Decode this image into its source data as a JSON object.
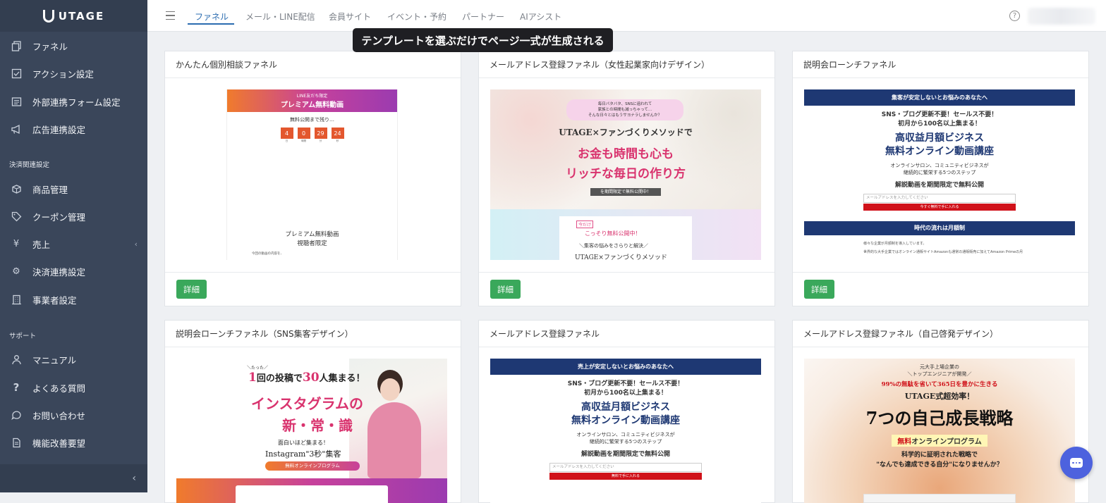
{
  "sidebar": {
    "logo": "UTAGE",
    "items_main": [
      {
        "label": "ファネル",
        "icon": "copy-icon"
      },
      {
        "label": "アクション設定",
        "icon": "checkbox-icon"
      },
      {
        "label": "外部連携フォーム設定",
        "icon": "list-icon"
      },
      {
        "label": "広告連携設定",
        "icon": "megaphone-icon"
      }
    ],
    "section_payment": "決済関連設定",
    "items_payment": [
      {
        "label": "商品管理",
        "icon": "box-icon"
      },
      {
        "label": "クーポン管理",
        "icon": "tag-icon"
      },
      {
        "label": "売上",
        "icon": "yen-icon"
      },
      {
        "label": "決済連携設定",
        "icon": "gear-icon"
      },
      {
        "label": "事業者設定",
        "icon": "building-icon"
      }
    ],
    "section_support": "サポート",
    "items_support": [
      {
        "label": "マニュアル",
        "icon": "person-icon"
      },
      {
        "label": "よくある質問",
        "icon": "question-icon"
      },
      {
        "label": "お問い合わせ",
        "icon": "chat-icon"
      },
      {
        "label": "機能改善要望",
        "icon": "document-icon"
      }
    ]
  },
  "topbar": {
    "tabs": [
      "ファネル",
      "メール・LINE配信",
      "会員サイト",
      "イベント・予約",
      "パートナー",
      "AIアシスト"
    ],
    "active_tab": "ファネル"
  },
  "banner": "テンプレートを選ぶだけでページ一式が生成される",
  "cards": [
    {
      "title": "かんたん個別相談ファネル",
      "button": "詳細",
      "preview": {
        "top": "LINE友だち限定",
        "headline": "プレミアム無料動画",
        "sub": "無料公開まで残り…",
        "countdown": [
          "4",
          "0",
          "29",
          "24"
        ],
        "units": [
          "日",
          "時間",
          "分",
          "秒"
        ],
        "bottom1": "プレミアム無料動画",
        "bottom2": "視聴者限定",
        "small": "今回の動画の内容を、"
      }
    },
    {
      "title": "メールアドレス登録ファネル（女性起業家向けデザイン）",
      "button": "詳細",
      "preview": {
        "bubble1": "毎日バタバタ、SNSに追われて",
        "bubble2": "家族との時間も減っちゃって…",
        "bubble3": "そんな日々とはもうサヨナラしませんか？",
        "line1": "UTAGE×ファンづくりメソッドで",
        "line2": "お金も時間も心も",
        "line3": "リッチな毎日の作り方",
        "badge": "を期間限定で無料公開中！",
        "stamp": "今だけ",
        "sub1": "こっそり無料公開中！",
        "sub2": "＼集客の悩みをさらりと解決／",
        "sub3": "UTAGE×ファンづくりメソッド"
      }
    },
    {
      "title": "説明会ローンチファネル",
      "button": "詳細",
      "preview": {
        "header": "集客が安定しないとお悩みのあなたへ",
        "l1": "SNS・ブログ更新不要！セールス不要！",
        "l2": "初月から100名以上集まる！",
        "h1": "高収益月額ビジネス",
        "h2": "無料オンライン動画講座",
        "s1": "オンラインサロン、コミュニティビジネスが",
        "s2": "継続的に繁栄する5つのステップ",
        "b": "解説動画を期間限定で無料公開",
        "placeholder": "メールアドレスを入力してください",
        "cta": "今すぐ無料で手に入れる",
        "header2": "時代の流れは月額制",
        "p1": "様々な企業が月額制を導入しています。",
        "p2": "世界的な大手企業ではオンライン通販サイトAmazonも通常の通販販売に加えてAmazon Primeの月"
      }
    },
    {
      "title": "説明会ローンチファネル（SNS集客デザイン）",
      "preview": {
        "top": "＼たった／",
        "l1a": "1",
        "l1b": "回の投稿で",
        "l1c": "30",
        "l1d": "人集まる！",
        "big1": "インスタグラムの",
        "big2": "新・常・識",
        "s1": "面白いほど集まる！",
        "s2": "Instagram\"3秒\"集客",
        "badge": "無料オンラインプログラム"
      }
    },
    {
      "title": "メールアドレス登録ファネル",
      "preview": {
        "header": "売上が安定しないとお悩みのあなたへ",
        "l1": "SNS・ブログ更新不要！セールス不要！",
        "l2": "初月から100名以上集まる！",
        "h1": "高収益月額ビジネス",
        "h2": "無料オンライン動画講座",
        "s1": "オンラインサロン、コミュニティビジネスが",
        "s2": "継続的に繁栄する5つのステップ",
        "b": "解説動画を期間限定で無料公開",
        "placeholder": "メールアドレスを入力してください",
        "cta": "無料で手に入れる"
      }
    },
    {
      "title": "メールアドレス登録ファネル（自己啓発デザイン）",
      "preview": {
        "t1": "元大手上場企業の",
        "t2": "＼トップエンジニアが開発／",
        "t3": "99%の無駄を省いて365日を豊かに生きる",
        "t4": "UTAGE式超効率！",
        "big": "7つの自己成長戦略",
        "t5a": "無料",
        "t5b": "オンラインプログラム",
        "t6": "科学的に証明された戦略で",
        "t7": "\"なんでも達成できる自分\"になりませんか？"
      }
    }
  ]
}
